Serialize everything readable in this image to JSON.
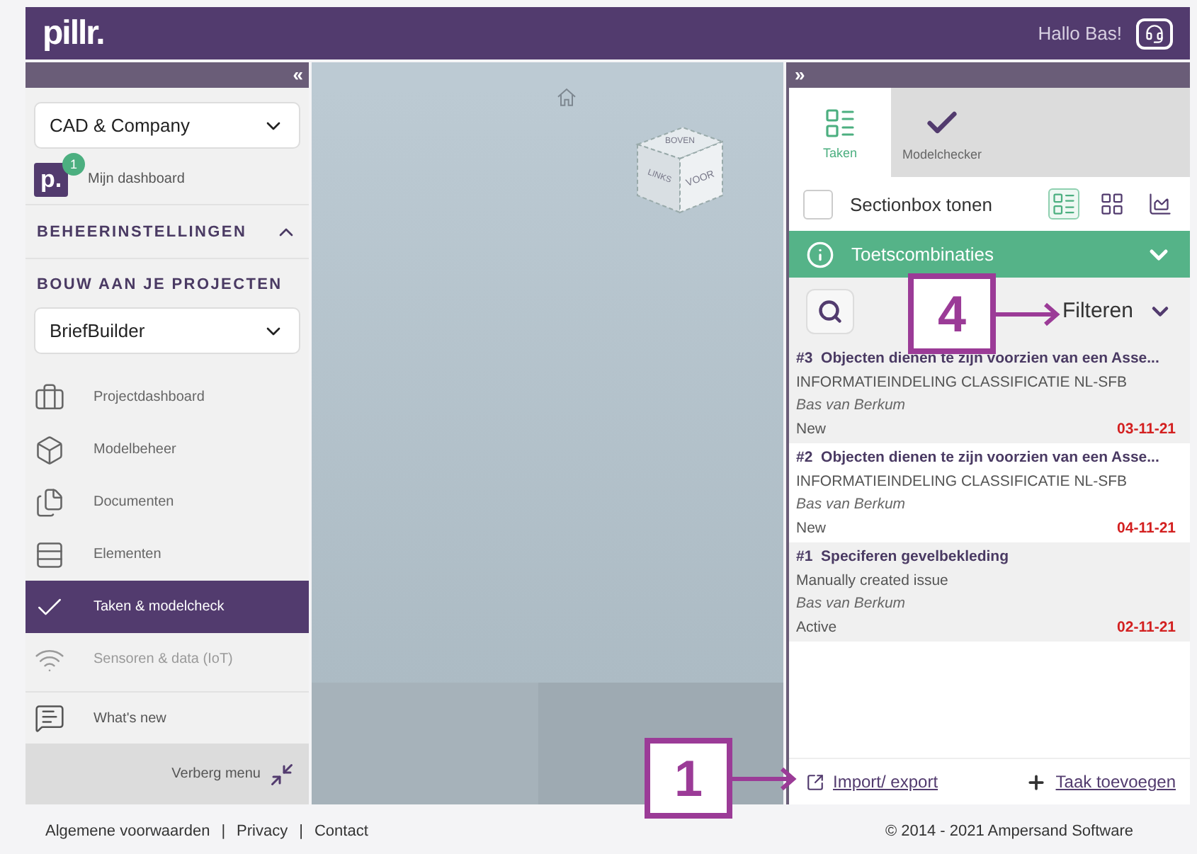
{
  "header": {
    "logo": "pillr.",
    "greeting": "Hallo Bas!"
  },
  "sidebar": {
    "collapse": "«",
    "company_select": "CAD & Company",
    "dashboard": {
      "label": "Mijn dashboard",
      "badge": "1",
      "logo": "p."
    },
    "section": {
      "label": "BEHEERINSTELLINGEN",
      "expanded": true
    },
    "projects_heading": "BOUW AAN JE PROJECTEN",
    "project_select": "BriefBuilder",
    "nav_items": [
      {
        "label": "Projectdashboard",
        "selected": false,
        "disabled": false
      },
      {
        "label": "Modelbeheer",
        "selected": false,
        "disabled": false
      },
      {
        "label": "Documenten",
        "selected": false,
        "disabled": false
      },
      {
        "label": "Elementen",
        "selected": false,
        "disabled": false
      },
      {
        "label": "Taken & modelcheck",
        "selected": true,
        "disabled": false
      },
      {
        "label": "Sensoren & data (IoT)",
        "selected": false,
        "disabled": true
      }
    ],
    "whats_new": "What's new",
    "hide_menu": "Verberg menu"
  },
  "viewer": {
    "cube_faces": [
      "BOVEN",
      "LINKS",
      "VOOR"
    ]
  },
  "panel": {
    "expand": "»",
    "tabs": [
      {
        "label": "Taken",
        "selected": true
      },
      {
        "label": "Modelchecker",
        "selected": false
      }
    ],
    "sectionbox": {
      "label": "Sectionbox tonen",
      "checked": false
    },
    "view_modes": [
      {
        "kind": "list",
        "selected": true
      },
      {
        "kind": "grid",
        "selected": false
      },
      {
        "kind": "chart",
        "selected": false
      }
    ],
    "shortcuts": {
      "label": "Toetscombinaties",
      "expanded": false
    },
    "filter": "Filteren",
    "tasks": [
      {
        "number": "#3",
        "title": "Objecten dienen te zijn voorzien van een Asse...",
        "category": "INFORMATIEINDELING CLASSIFICATIE NL-SFB",
        "author": "Bas van Berkum",
        "status": "New",
        "date": "03-11-21"
      },
      {
        "number": "#2",
        "title": "Objecten dienen te zijn voorzien van een Asse...",
        "category": "INFORMATIEINDELING CLASSIFICATIE NL-SFB",
        "author": "Bas van Berkum",
        "status": "New",
        "date": "04-11-21"
      },
      {
        "number": "#1",
        "title": "Speciferen gevelbekleding",
        "category": "Manually created issue",
        "author": "Bas van Berkum",
        "status": "Active",
        "date": "02-11-21"
      }
    ],
    "import_export": "Import/ export",
    "add_task": "Taak toevoegen"
  },
  "footer": {
    "links": [
      "Algemene voorwaarden",
      "Privacy",
      "Contact"
    ],
    "separator": "|",
    "copyright": "© 2014 - 2021 Ampersand Software"
  },
  "callouts": [
    {
      "number": "4"
    },
    {
      "number": "1"
    }
  ]
}
